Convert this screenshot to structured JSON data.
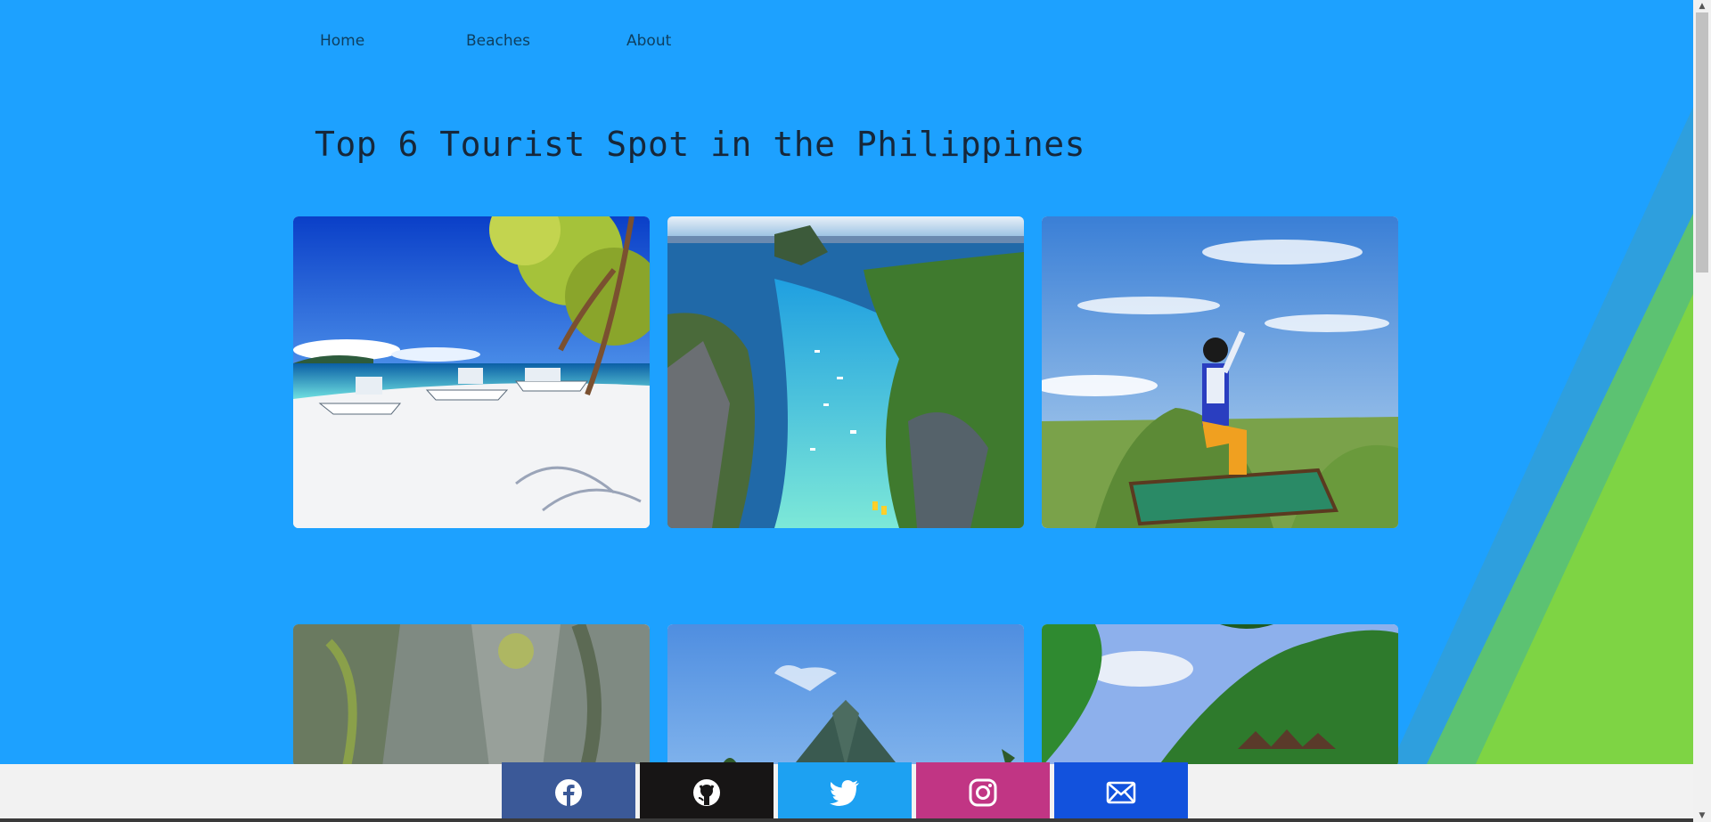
{
  "nav": {
    "items": [
      {
        "label": "Home"
      },
      {
        "label": "Beaches"
      },
      {
        "label": "About"
      }
    ]
  },
  "page": {
    "title": "Top 6 Tourist Spot in the Philippines"
  },
  "gallery": {
    "photos": [
      {
        "subject": "white sand beach with outrigger boats"
      },
      {
        "subject": "aerial view of lagoon with limestone cliffs"
      },
      {
        "subject": "man kneeling on green platform over mountains"
      },
      {
        "subject": "limestone cliff wall"
      },
      {
        "subject": "volcano under blue sky"
      },
      {
        "subject": "forested mountain with huts"
      }
    ]
  },
  "footer": {
    "social": [
      {
        "icon": "facebook-icon",
        "color": "#3b5998"
      },
      {
        "icon": "github-icon",
        "color": "#171515"
      },
      {
        "icon": "twitter-icon",
        "color": "#1da1f2"
      },
      {
        "icon": "instagram-icon",
        "color": "#c13584"
      },
      {
        "icon": "mail-icon",
        "color": "#1252dd"
      }
    ]
  },
  "colors": {
    "background": "#1da1ff",
    "stripe_1": "#2e9fde",
    "stripe_2": "#5cc272",
    "stripe_3": "#7ed444",
    "footer_bg": "#f2f2f2"
  }
}
